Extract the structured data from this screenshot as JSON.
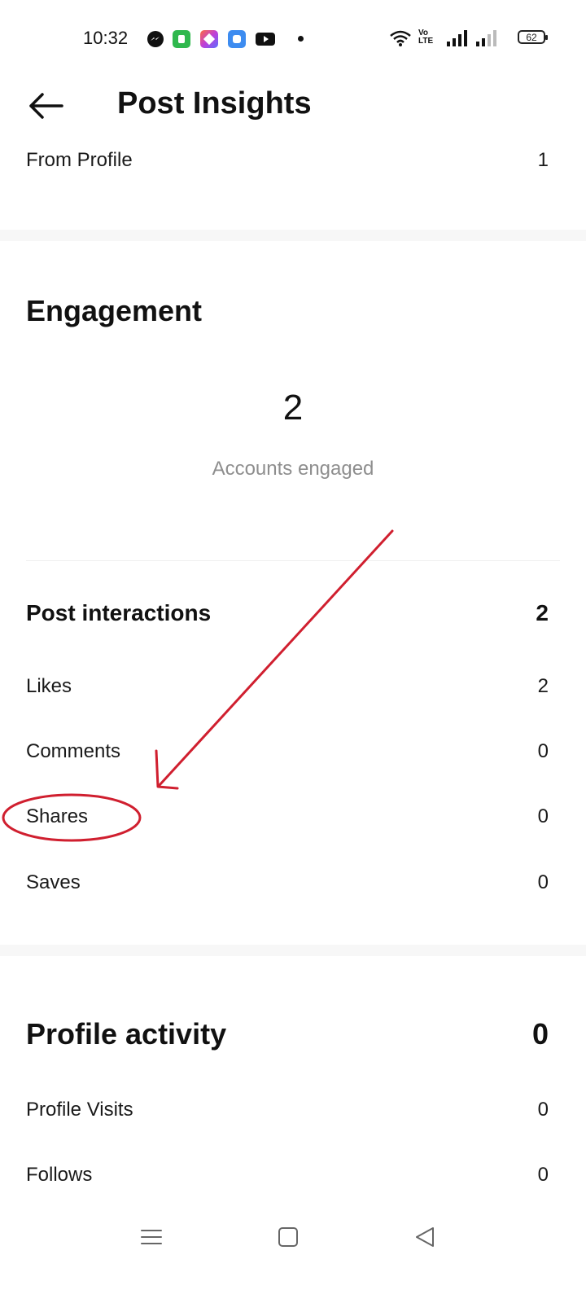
{
  "status_bar": {
    "time": "10:32",
    "battery": "62",
    "icons": [
      "messenger-icon",
      "green-app-icon",
      "gradient-app-icon",
      "blue-app-icon",
      "youtube-icon",
      "notification-dot",
      "wifi-icon",
      "volte-icon",
      "signal-icon",
      "signal-icon-2",
      "battery-icon"
    ]
  },
  "header": {
    "title": "Post Insights",
    "back_icon": "back-arrow-icon"
  },
  "from_profile": {
    "label": "From Profile",
    "value": "1"
  },
  "engagement": {
    "heading": "Engagement",
    "accounts_engaged_value": "2",
    "accounts_engaged_label": "Accounts engaged",
    "post_interactions": {
      "label": "Post interactions",
      "value": "2"
    },
    "items": [
      {
        "label": "Likes",
        "value": "2"
      },
      {
        "label": "Comments",
        "value": "0"
      },
      {
        "label": "Shares",
        "value": "0"
      },
      {
        "label": "Saves",
        "value": "0"
      }
    ]
  },
  "profile_activity": {
    "heading": "Profile activity",
    "value": "0",
    "items": [
      {
        "label": "Profile Visits",
        "value": "0"
      },
      {
        "label": "Follows",
        "value": "0"
      }
    ]
  },
  "annotation": {
    "color": "#d01f2f"
  },
  "nav_bar": {
    "icons": [
      "menu-icon",
      "home-square-icon",
      "back-triangle-icon"
    ]
  }
}
